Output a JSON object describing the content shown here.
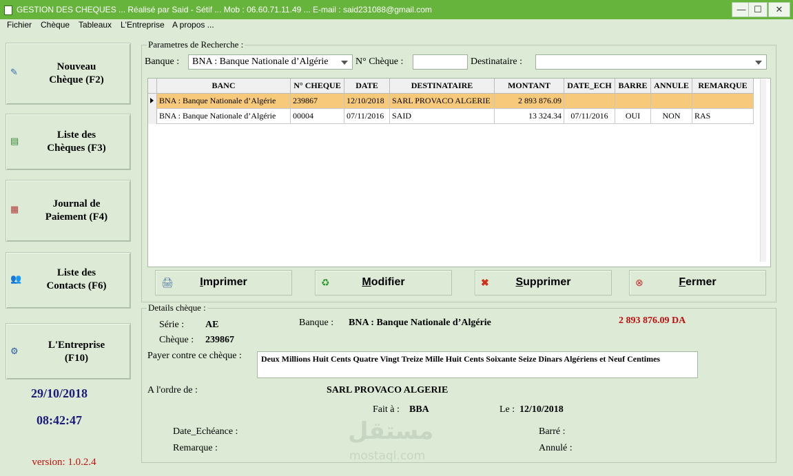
{
  "window": {
    "title": "GESTION DES CHEQUES  ...  Réalisé par Said - Sétif   ...  Mob : 06.60.71.11.49   ...   E-mail : said231088@gmail.com",
    "minimize": "—",
    "maximize": "☐",
    "close": "✕"
  },
  "menu": [
    "Fichier",
    "Chèque",
    "Tableaux",
    "L'Entreprise",
    "A propos ..."
  ],
  "sidebar": {
    "buttons": [
      {
        "line1": "Nouveau",
        "line2": "Chèque (F2)",
        "icon": "pencil-icon"
      },
      {
        "line1": "Liste des",
        "line2": "Chèques (F3)",
        "icon": "list-icon"
      },
      {
        "line1": "Journal de",
        "line2": "Paiement (F4)",
        "icon": "calendar-icon"
      },
      {
        "line1": "Liste des",
        "line2": "Contacts (F6)",
        "icon": "contacts-icon"
      },
      {
        "line1": "L'Entreprise",
        "line2": "(F10)",
        "icon": "company-icon"
      }
    ],
    "date": "29/10/2018",
    "time": "08:42:47",
    "version": "version: 1.0.2.4"
  },
  "search": {
    "legend": "Parametres de Recherche :",
    "bank_label": "Banque :",
    "bank_value": "BNA : Banque Nationale d’Algérie",
    "cheque_label": "N° Chèque :",
    "cheque_value": "",
    "dest_label": "Destinataire :",
    "dest_value": ""
  },
  "table": {
    "columns": [
      "BANC",
      "N° CHEQUE",
      "DATE",
      "DESTINATAIRE",
      "MONTANT",
      "DATE_ECH",
      "BARRE",
      "ANNULE",
      "REMARQUE"
    ],
    "rows": [
      [
        "BNA : Banque Nationale d’Algérie",
        "239867",
        "12/10/2018",
        "SARL PROVACO ALGERIE",
        "2 893 876.09",
        "",
        "",
        "",
        ""
      ],
      [
        "BNA : Banque Nationale d’Algérie",
        "00004",
        "07/11/2016",
        "SAID",
        "13 324.34",
        "07/11/2016",
        "OUI",
        "NON",
        "RAS"
      ]
    ],
    "selected_row": 0
  },
  "actions": {
    "print": {
      "pre": "",
      "key": "I",
      "rest": "mprimer"
    },
    "edit": {
      "pre": "",
      "key": "M",
      "rest": "odifier"
    },
    "delete": {
      "pre": "",
      "key": "S",
      "rest": "upprimer"
    },
    "close": {
      "pre": "",
      "key": "F",
      "rest": "ermer"
    }
  },
  "details": {
    "legend": "Details chèque :",
    "serie_label": "Série :",
    "serie_value": "AE",
    "cheque_label": "Chèque :",
    "cheque_value": "239867",
    "bank_label": "Banque :",
    "bank_value": "BNA : Banque Nationale d’Algérie",
    "amount": "2 893 876.09  DA",
    "pay_label": "Payer contre ce chèque :",
    "amount_words": "Deux Millions Huit Cents Quatre Vingt Treize Mille Huit Cents Soixante Seize Dinars Algériens et  Neuf Centimes",
    "order_label": "A l'ordre de :",
    "order_value": "SARL PROVACO ALGERIE",
    "place_label": "Fait à :",
    "place_value": "BBA",
    "date_label": "Le :",
    "date_value": "12/10/2018",
    "due_label": "Date_Echéance :",
    "remark_label": "Remarque :",
    "barre_label": "Barré :",
    "annule_label": "Annulé :"
  },
  "watermark": {
    "arabic": "مستقل",
    "latin": "mostaql.com"
  },
  "colors": {
    "accent": "#67b43c",
    "amount": "#c01010",
    "clock": "#1a1a7a",
    "selection": "#f7c97a"
  }
}
